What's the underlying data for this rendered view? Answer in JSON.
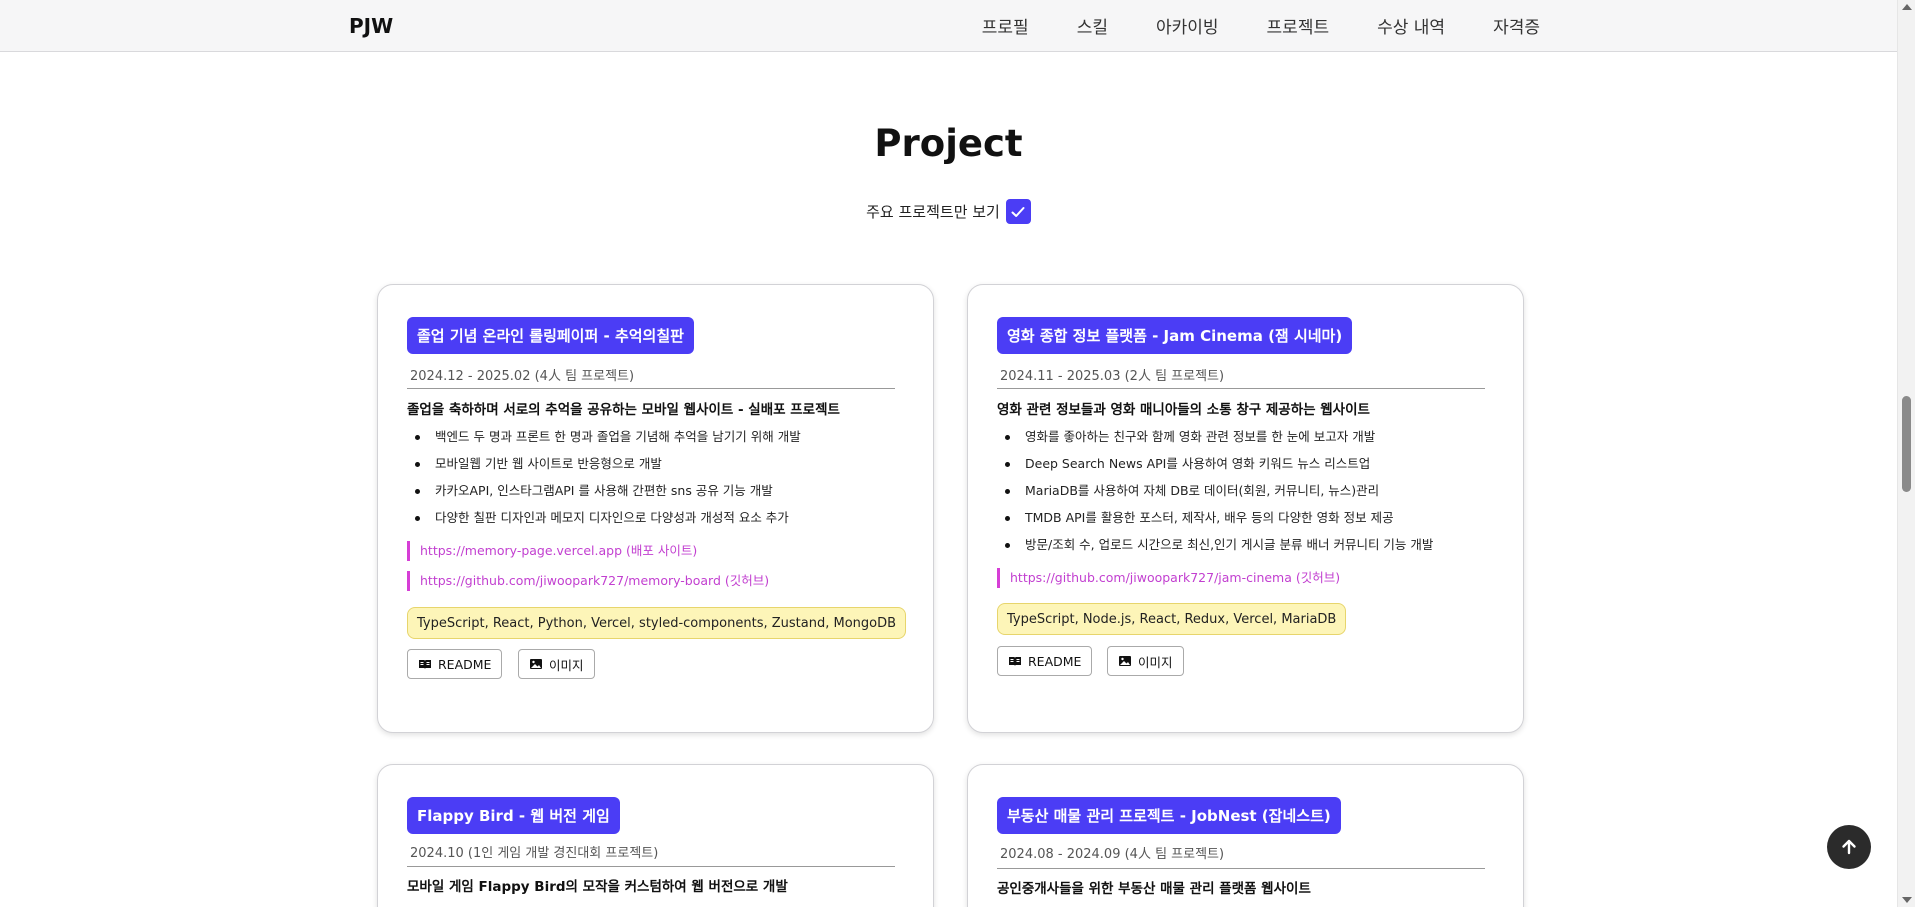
{
  "navbar": {
    "brand": "PJW",
    "links": [
      "프로필",
      "스킬",
      "아카이빙",
      "프로젝트",
      "수상 내역",
      "자격증"
    ]
  },
  "section": {
    "title": "Project",
    "toggle_label": "주요 프로젝트만 보기",
    "toggle_checked": true
  },
  "projects": [
    {
      "title": "졸업 기념 온라인 롤링페이퍼 - 추억의칠판",
      "period": "2024.12 - 2025.02 (4人 팀 프로젝트)",
      "description": "졸업을 축하하며 서로의 추억을 공유하는 모바일 웹사이트 - 실배포 프로젝트",
      "bullets": [
        "백엔드 두 명과 프론트 한 명과 졸업을 기념해 추억을 남기기 위해 개발",
        "모바일웹 기반 웹 사이트로 반응형으로 개발",
        "카카오API, 인스타그램API 를 사용해 간편한 sns 공유 기능 개발",
        "다양한 칠판 디자인과 메모지 디자인으로 다양성과 개성적 요소 추가"
      ],
      "links": [
        "https://memory-page.vercel.app (배포 사이트)",
        "https://github.com/jiwoopark727/memory-board (깃허브)"
      ],
      "tech": "TypeScript, React, Python, Vercel, styled-components, Zustand, MongoDB",
      "readme_label": "README",
      "image_label": "이미지"
    },
    {
      "title": "영화 종합 정보 플랫폼 - Jam Cinema (잼 시네마)",
      "period": "2024.11 - 2025.03 (2人 팀 프로젝트)",
      "description": "영화 관련 정보들과 영화 매니아들의 소통 창구 제공하는 웹사이트",
      "bullets": [
        "영화를 좋아하는 친구와 함께 영화 관련 정보를 한 눈에 보고자 개발",
        "Deep Search News API를 사용하여 영화 키워드 뉴스 리스트업",
        "MariaDB를 사용하여 자체 DB로 데이터(회원, 커뮤니티, 뉴스)관리",
        "TMDB API를 활용한 포스터, 제작사, 배우 등의 다양한 영화 정보 제공",
        "방문/조회 수, 업로드 시간으로 최신,인기 게시글 분류 배너 커뮤니티 기능 개발"
      ],
      "links": [
        "https://github.com/jiwoopark727/jam-cinema (깃허브)"
      ],
      "tech": "TypeScript, Node.js, React, Redux, Vercel, MariaDB",
      "readme_label": "README",
      "image_label": "이미지"
    },
    {
      "title": "Flappy Bird - 웹 버전 게임",
      "period": "2024.10 (1인 게임 개발 경진대회 프로젝트)",
      "description": "모바일 게임 Flappy Bird의 모작을 커스텀하여 웹 버전으로 개발"
    },
    {
      "title": "부동산 매물 관리 프로젝트 - JobNest (잡네스트)",
      "period": "2024.08 - 2024.09 (4人 팀 프로젝트)",
      "description": "공인중개사들을 위한 부동산 매물 관리 플랫폼 웹사이트"
    }
  ],
  "colors": {
    "accent": "#4b3df5",
    "link": "#c23fd0",
    "tag_bg": "#fdf5b8"
  },
  "icons": {
    "readme": "book-icon",
    "image": "image-icon",
    "check": "check-icon",
    "top": "arrow-up-icon"
  }
}
